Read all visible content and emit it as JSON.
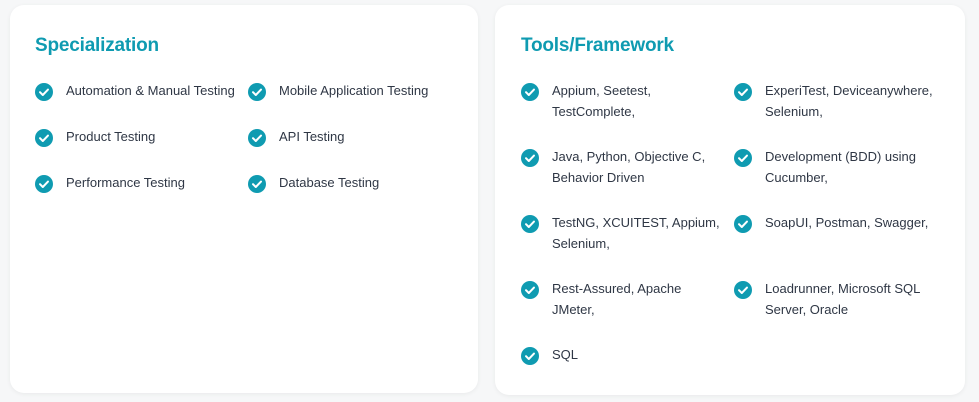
{
  "colors": {
    "accent": "#0f9bb1",
    "text": "#2f3745",
    "card_background": "#ffffff",
    "page_background": "#f6f7f8"
  },
  "icon": "check-circle-icon",
  "specialization": {
    "title": "Specialization",
    "items": [
      {
        "label": "Automation & Manual Testing"
      },
      {
        "label": "Mobile Application Testing"
      },
      {
        "label": "Product Testing"
      },
      {
        "label": "API Testing"
      },
      {
        "label": "Performance Testing"
      },
      {
        "label": "Database Testing"
      }
    ]
  },
  "tools": {
    "title": "Tools/Framework",
    "items": [
      {
        "line1": "Appium, Seetest,",
        "line2": "TestComplete,"
      },
      {
        "line1": "ExperiTest, Deviceanywhere,",
        "line2": "Selenium,"
      },
      {
        "line1": "Java, Python, Objective C,",
        "line2": "Behavior Driven"
      },
      {
        "line1": "Development (BDD) using",
        "line2": "Cucumber,"
      },
      {
        "line1": "TestNG, XCUITEST, Appium,",
        "line2": "Selenium,"
      },
      {
        "line1": "SoapUI, Postman, Swagger,",
        "line2": ""
      },
      {
        "line1": "Rest-Assured, Apache JMeter,",
        "line2": ""
      },
      {
        "line1": "Loadrunner, Microsoft SQL",
        "line2": "Server, Oracle"
      },
      {
        "line1": "SQL",
        "line2": ""
      }
    ]
  }
}
